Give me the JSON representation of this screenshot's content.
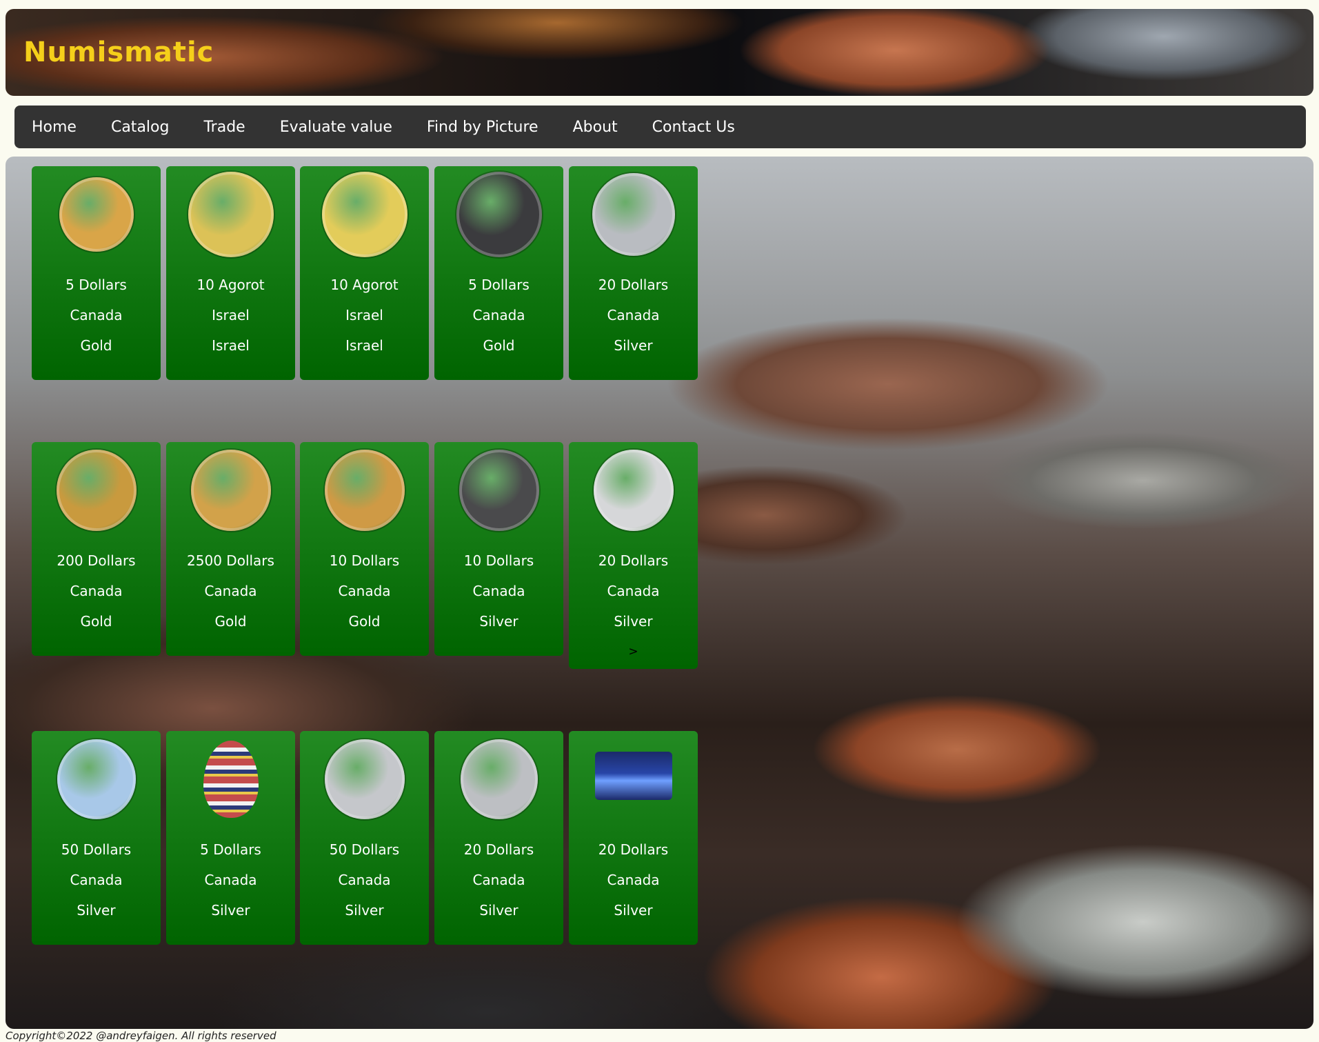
{
  "header": {
    "title": "Numismatic"
  },
  "nav": {
    "items": [
      "Home",
      "Catalog",
      "Trade",
      "Evaluate value",
      "Find by Picture",
      "About",
      "Contact Us"
    ]
  },
  "cards": [
    {
      "denomination": "5 Dollars",
      "country": "Canada",
      "material": "Gold",
      "coin_icon": "gold-maple-leaf-coin",
      "coin_color": "#d9a548"
    },
    {
      "denomination": "10 Agorot",
      "country": "Israel",
      "material": "Israel",
      "coin_icon": "gold-10-agorot-coin",
      "coin_color": "#dcc257"
    },
    {
      "denomination": "10 Agorot",
      "country": "Israel",
      "material": "Israel",
      "coin_icon": "gold-menorah-coin",
      "coin_color": "#e3cc5a"
    },
    {
      "denomination": "5 Dollars",
      "country": "Canada",
      "material": "Gold",
      "coin_icon": "black-gold-maple-coin",
      "coin_color": "#3b3b3e"
    },
    {
      "denomination": "20 Dollars",
      "country": "Canada",
      "material": "Silver",
      "coin_icon": "silver-earth-drop-coin",
      "coin_color": "#b9bcc1"
    },
    {
      "denomination": "200 Dollars",
      "country": "Canada",
      "material": "Gold",
      "coin_icon": "gold-sapphire-coin",
      "coin_color": "#c99a3e"
    },
    {
      "denomination": "2500 Dollars",
      "country": "Canada",
      "material": "Gold",
      "coin_icon": "gold-rabbit-coin",
      "coin_color": "#d2a24a"
    },
    {
      "denomination": "10 Dollars",
      "country": "Canada",
      "material": "Gold",
      "coin_icon": "gold-maple-2022-coin",
      "coin_color": "#cf9a45"
    },
    {
      "denomination": "10 Dollars",
      "country": "Canada",
      "material": "Silver",
      "coin_icon": "black-silver-animal-coin",
      "coin_color": "#4a4a4c"
    },
    {
      "denomination": "20 Dollars",
      "country": "Canada",
      "material": "Silver",
      "more": ">",
      "coin_icon": "silver-tartan-coin",
      "coin_color": "#d6d7d9"
    },
    {
      "denomination": "50 Dollars",
      "country": "Canada",
      "material": "Silver",
      "coin_icon": "silver-colored-maple-coin",
      "coin_color": "#a8c8e8"
    },
    {
      "denomination": "5 Dollars",
      "country": "Canada",
      "material": "Silver",
      "coin_icon": "pysanka-egg-coin",
      "coin_color": "#c44c4c"
    },
    {
      "denomination": "50 Dollars",
      "country": "Canada",
      "material": "Silver",
      "coin_icon": "silver-compass-gem-coin",
      "coin_color": "#c5c7cb"
    },
    {
      "denomination": "20 Dollars",
      "country": "Canada",
      "material": "Silver",
      "coin_icon": "silver-queen-portrait-coin",
      "coin_color": "#bdbfc3"
    },
    {
      "denomination": "20 Dollars",
      "country": "Canada",
      "material": "Silver",
      "coin_icon": "blue-rectangular-aurora-coin",
      "coin_color": "#2846a8"
    }
  ],
  "footer": {
    "text": "Copyright©2022 @andreyfaigen. All rights reserved"
  }
}
